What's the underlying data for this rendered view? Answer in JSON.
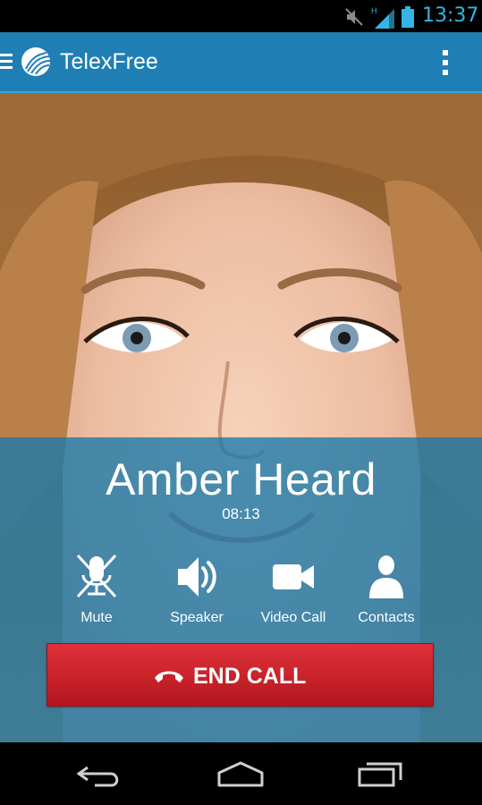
{
  "status_bar": {
    "time": "13:37",
    "network_type": "H",
    "icons": [
      "mute-icon",
      "signal-icon",
      "battery-icon"
    ]
  },
  "app_bar": {
    "title": "TelexFree",
    "icons": [
      "menu-icon",
      "telexfree-logo",
      "overflow-menu-icon"
    ]
  },
  "call": {
    "caller_name": "Amber Heard",
    "duration": "08:13"
  },
  "actions": [
    {
      "label": "Mute",
      "icon": "mic-muted-icon"
    },
    {
      "label": "Speaker",
      "icon": "speaker-icon"
    },
    {
      "label": "Video Call",
      "icon": "video-camera-icon"
    },
    {
      "label": "Contacts",
      "icon": "contact-person-icon"
    }
  ],
  "end_call": {
    "label": "END CALL",
    "icon": "hang-up-phone-icon"
  },
  "nav_bar": {
    "icons": [
      "back-icon",
      "home-icon",
      "recent-apps-icon"
    ]
  },
  "colors": {
    "status_accent": "#33b5e5",
    "app_bar": "#1f7fb5",
    "call_panel": "#1878aa",
    "end_call": "#c8222a"
  }
}
